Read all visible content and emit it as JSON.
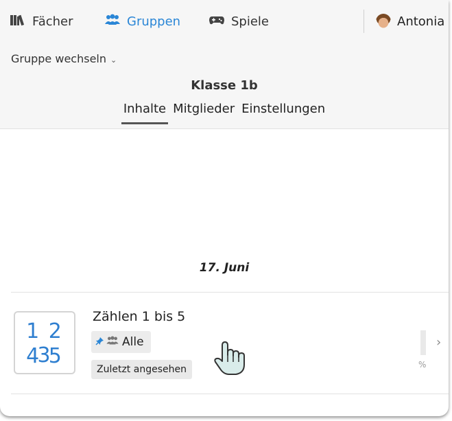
{
  "nav": {
    "subjects": "Fächer",
    "groups": "Gruppen",
    "games": "Spiele",
    "user": "Antonia"
  },
  "group_switcher": {
    "label": "Gruppe wechseln"
  },
  "group": {
    "title": "Klasse 1b",
    "tabs": [
      {
        "label": "Inhalte",
        "active": true
      },
      {
        "label": "Mitglieder",
        "active": false
      },
      {
        "label": "Einstellungen",
        "active": false
      }
    ]
  },
  "timeline": {
    "date": "17. Juni",
    "items": [
      {
        "thumb_line1": "1 2 3",
        "thumb_line2": "4 5",
        "title": "Zählen 1 bis 5",
        "audience": "Alle",
        "status": "Zuletzt angesehen",
        "progress_label": "%",
        "progress": 0
      }
    ]
  },
  "colors": {
    "accent": "#2a86d6",
    "nav_bg": "#f6f6f6"
  },
  "icons": [
    "books-icon",
    "users-icon",
    "gamepad-icon",
    "avatar",
    "pin-icon",
    "chevron-right-icon",
    "hand-pointer-icon"
  ]
}
